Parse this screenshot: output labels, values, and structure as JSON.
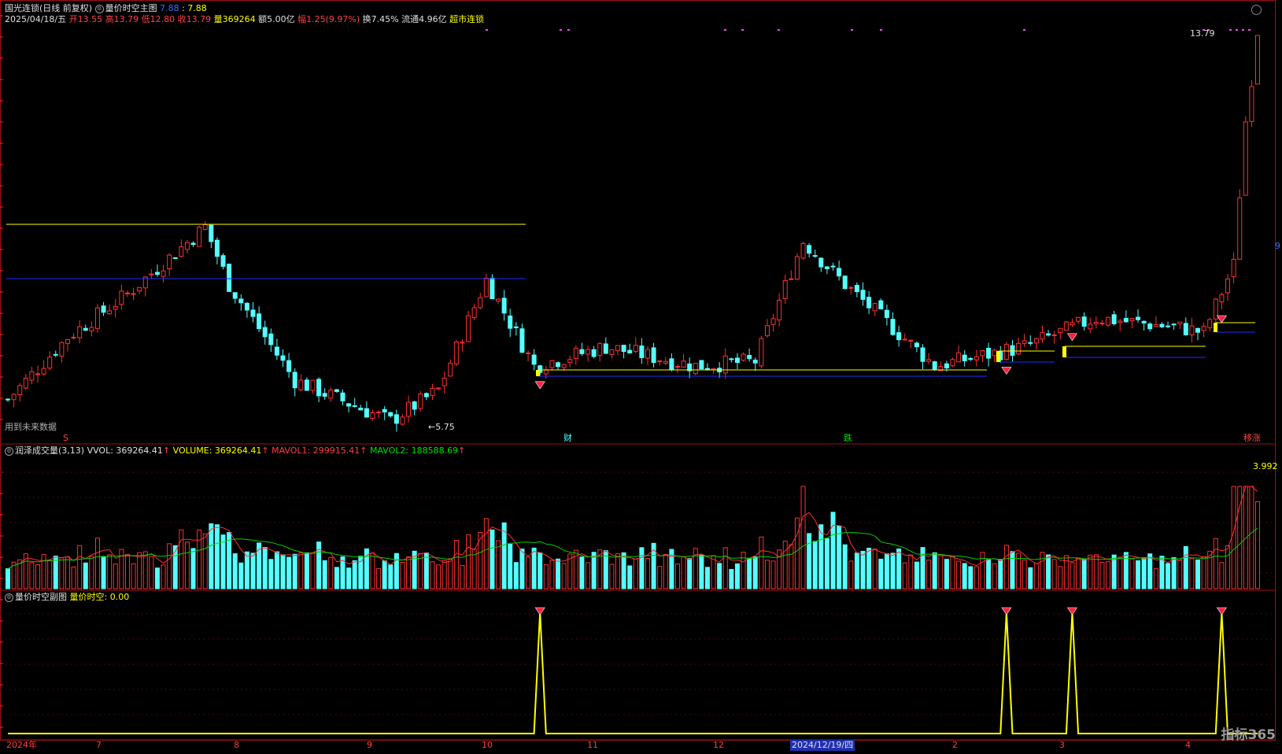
{
  "header": {
    "stock_name": "国光连锁",
    "period_mode": "(日线 前复权)",
    "indicator_name": "量价时空主图",
    "indicator_val1": "7.88",
    "indicator_val2": ": 7.88",
    "date": "2025/04/18/五",
    "open_label": "开",
    "open": "13.55",
    "high_label": "高",
    "high": "13.79",
    "low_label": "低",
    "low": "12.80",
    "close_label": "收",
    "close": "13.79",
    "vol_label": "量",
    "volume": "369264",
    "amount_label": "额",
    "amount": "5.00亿",
    "change_label": "幅",
    "change": "1.25(9.97%)",
    "turnover_label": "换",
    "turnover": "7.45%",
    "float_label": "流通",
    "float_cap": "4.96亿",
    "tag": "超市连锁"
  },
  "main_panel": {
    "price_high_label": "13.79",
    "price_low_label": "5.75",
    "future_data_note": "用到未来数据",
    "events": [
      "S",
      "财",
      "跌",
      "移涨"
    ]
  },
  "volume_panel": {
    "title": "润泽成交量",
    "params": "(3,13)",
    "vvol": "VVOL: 369264.41",
    "volume": "VOLUME: 369264.41",
    "mavol1": "MAVOL1: 299915.41",
    "mavol2": "MAVOL2: 188588.69",
    "scale_label": "3.992"
  },
  "signal_panel": {
    "title": "量价时空副图",
    "label": "量价时空: 0.00"
  },
  "time_axis": {
    "labels": [
      "2024年",
      "7",
      "8",
      "9",
      "10",
      "11",
      "12",
      "2",
      "3",
      "4"
    ],
    "cursor_label": "2024/12/19/四"
  },
  "right_edge_label": "9",
  "watermark": "指标365",
  "colors": {
    "up": "#ff3030",
    "down": "#54ffff",
    "ma1": "#ff3030",
    "ma2": "#00d000",
    "signal": "#ffff00",
    "support": "#2030ff"
  },
  "chart_data": {
    "type": "candlestick",
    "x_axis": "trading day index (~205 sessions, 2024 to 2025/04/18)",
    "price_extremes": {
      "high": 13.79,
      "low": 5.75
    },
    "last_bar": {
      "date": "2025/04/18",
      "open": 13.55,
      "high": 13.79,
      "low": 12.8,
      "close": 13.79,
      "volume": 369264
    },
    "signal_positions": [
      89,
      167,
      178,
      203
    ],
    "signal_value_now": 0.0,
    "volume_indicator": {
      "vvol": 369264.41,
      "volume": 369264.41,
      "mavol1": 299915.41,
      "mavol2": 188588.69
    }
  }
}
